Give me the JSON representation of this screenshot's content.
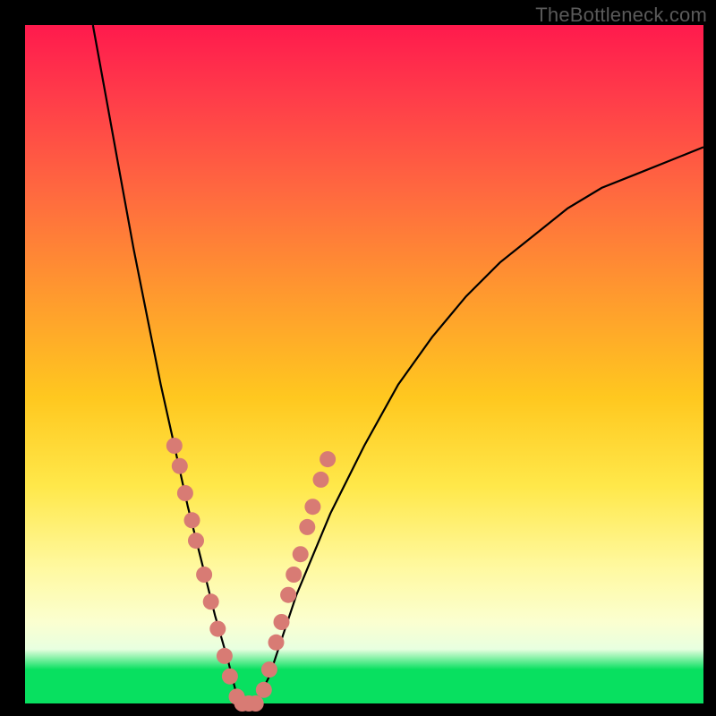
{
  "watermark": "TheBottleneck.com",
  "chart_data": {
    "type": "line",
    "title": "",
    "xlabel": "",
    "ylabel": "",
    "xlim": [
      0,
      100
    ],
    "ylim": [
      0,
      100
    ],
    "series": [
      {
        "name": "bottleneck-curve",
        "x": [
          10,
          12,
          14,
          16,
          18,
          20,
          22,
          24,
          26,
          28,
          30,
          31,
          32,
          34,
          36,
          38,
          40,
          45,
          50,
          55,
          60,
          65,
          70,
          75,
          80,
          85,
          90,
          95,
          100
        ],
        "values": [
          100,
          89,
          78,
          67,
          57,
          47,
          38,
          29,
          21,
          13,
          6,
          2,
          0,
          0,
          4,
          10,
          16,
          28,
          38,
          47,
          54,
          60,
          65,
          69,
          73,
          76,
          78,
          80,
          82
        ]
      }
    ],
    "markers": {
      "name": "highlight-dots",
      "color": "#d87b74",
      "points": [
        {
          "x": 22.0,
          "y": 38
        },
        {
          "x": 22.8,
          "y": 35
        },
        {
          "x": 23.6,
          "y": 31
        },
        {
          "x": 24.6,
          "y": 27
        },
        {
          "x": 25.2,
          "y": 24
        },
        {
          "x": 26.4,
          "y": 19
        },
        {
          "x": 27.4,
          "y": 15
        },
        {
          "x": 28.4,
          "y": 11
        },
        {
          "x": 29.4,
          "y": 7
        },
        {
          "x": 30.2,
          "y": 4
        },
        {
          "x": 31.2,
          "y": 1
        },
        {
          "x": 32.0,
          "y": 0
        },
        {
          "x": 33.0,
          "y": 0
        },
        {
          "x": 34.0,
          "y": 0
        },
        {
          "x": 35.2,
          "y": 2
        },
        {
          "x": 36.0,
          "y": 5
        },
        {
          "x": 37.0,
          "y": 9
        },
        {
          "x": 37.8,
          "y": 12
        },
        {
          "x": 38.8,
          "y": 16
        },
        {
          "x": 39.6,
          "y": 19
        },
        {
          "x": 40.6,
          "y": 22
        },
        {
          "x": 41.6,
          "y": 26
        },
        {
          "x": 42.4,
          "y": 29
        },
        {
          "x": 43.6,
          "y": 33
        },
        {
          "x": 44.6,
          "y": 36
        }
      ]
    }
  }
}
